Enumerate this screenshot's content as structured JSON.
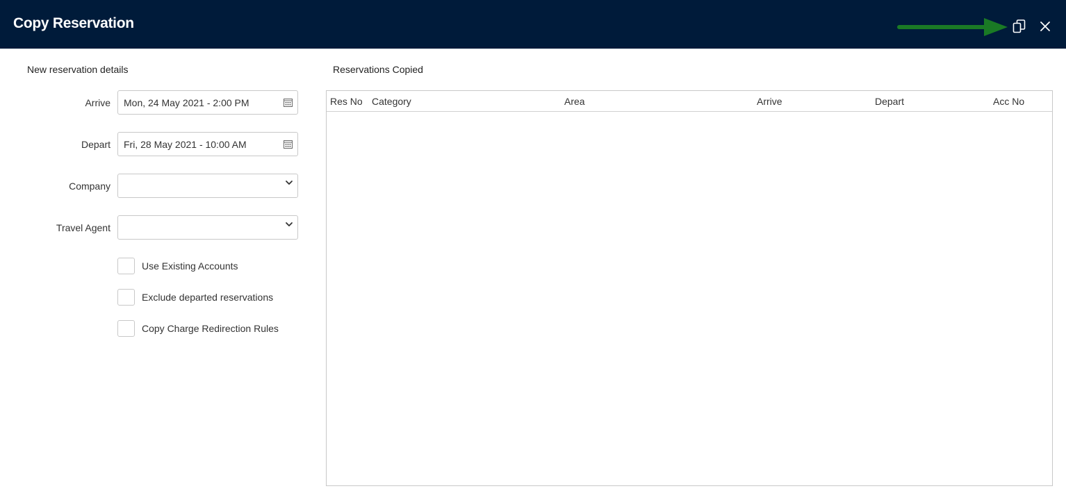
{
  "dialog": {
    "title": "Copy Reservation",
    "copy_icon": "copy-icon",
    "close_icon": "close-icon",
    "arrow_color": "#1a7a25",
    "header_color": "#001b3a"
  },
  "form": {
    "section_title": "New reservation details",
    "arrive": {
      "label": "Arrive",
      "value": "Mon, 24 May 2021 - 2:00 PM"
    },
    "depart": {
      "label": "Depart",
      "value": "Fri, 28 May 2021 - 10:00 AM"
    },
    "company": {
      "label": "Company",
      "value": ""
    },
    "travel_agent": {
      "label": "Travel Agent",
      "value": ""
    },
    "checkboxes": [
      {
        "label": "Use Existing Accounts",
        "checked": false
      },
      {
        "label": "Exclude departed reservations",
        "checked": false
      },
      {
        "label": "Copy Charge Redirection Rules",
        "checked": false
      }
    ]
  },
  "grid": {
    "section_title": "Reservations Copied",
    "columns": [
      "Res No",
      "Category",
      "Area",
      "Arrive",
      "Depart",
      "Acc No"
    ],
    "rows": []
  }
}
